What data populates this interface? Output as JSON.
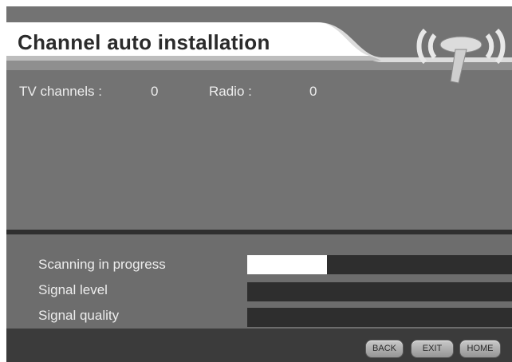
{
  "header": {
    "title": "Channel auto installation"
  },
  "counts": {
    "tv_label": "TV channels :",
    "tv_value": "0",
    "radio_label": "Radio :",
    "radio_value": "0"
  },
  "status": {
    "scanning_label": "Scanning in progress",
    "scanning_progress": 0.3,
    "signal_level_label": "Signal level",
    "signal_level": 0,
    "signal_quality_label": "Signal quality",
    "signal_quality": 0
  },
  "footer": {
    "back_label": "BACK",
    "exit_label": "EXIT",
    "home_label": "HOME"
  },
  "icons": {
    "antenna": "antenna-signal-icon"
  },
  "colors": {
    "background": "#737373",
    "bar_track": "#2e2e2e",
    "bar_fill": "#ffffff",
    "footer": "#3b3b3b"
  }
}
